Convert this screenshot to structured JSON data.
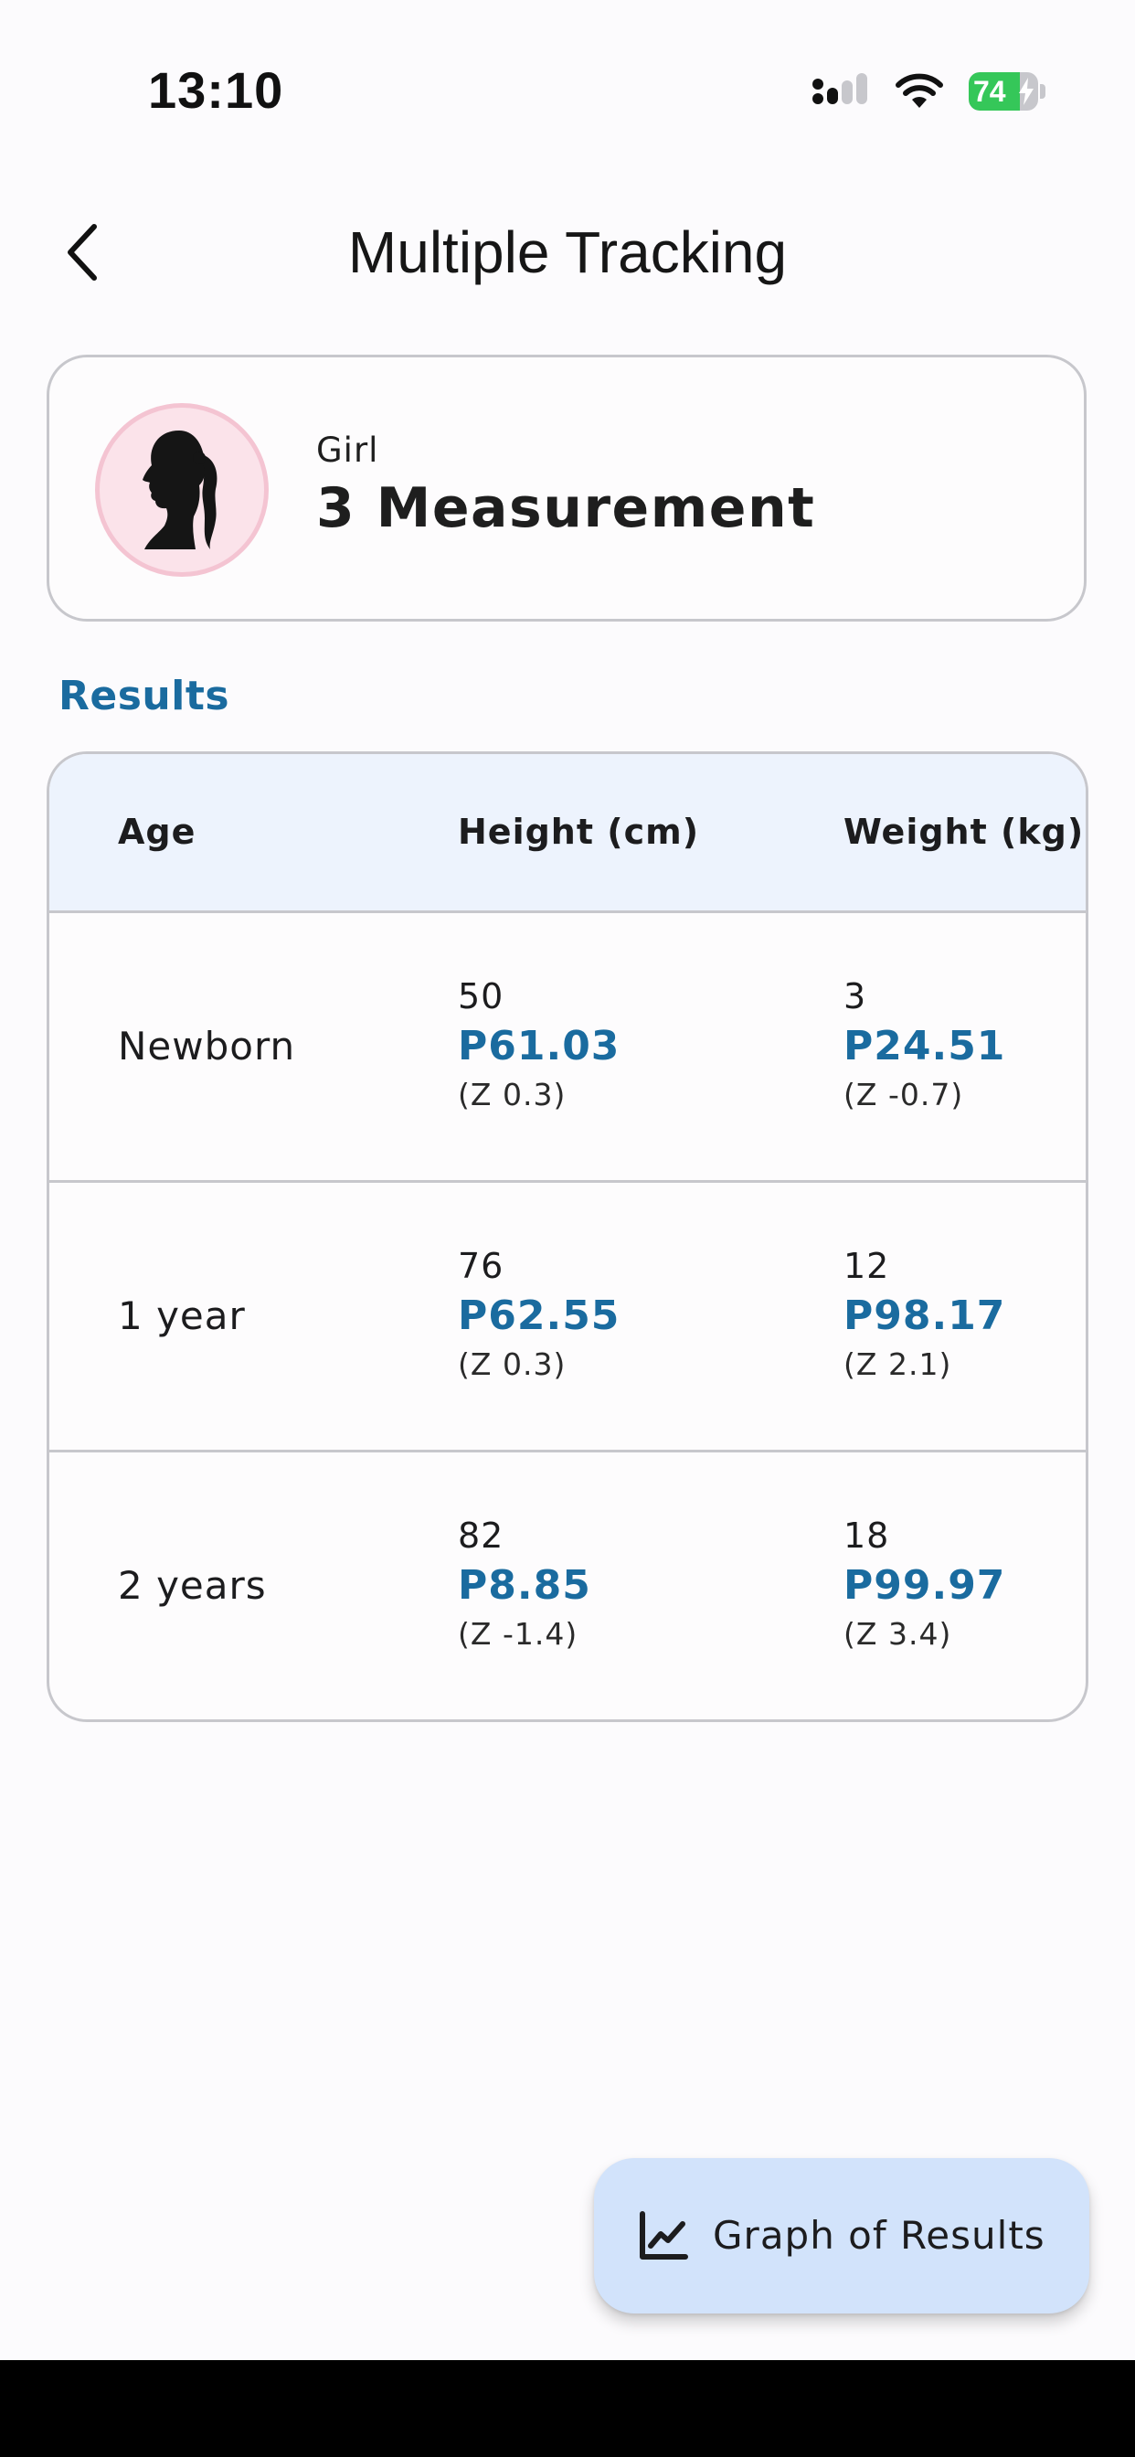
{
  "status_bar": {
    "time": "13:10",
    "battery_percent": "74",
    "battery_level": 0.74,
    "charging": true
  },
  "header": {
    "title": "Multiple Tracking",
    "back_icon": "chevron-left-icon"
  },
  "profile": {
    "gender_label": "Girl",
    "measurement_count": "3 Measurement",
    "avatar_icon": "girl-silhouette-icon"
  },
  "results": {
    "section_title": "Results",
    "columns": [
      "Age",
      "Height (cm)",
      "Weight (kg)"
    ],
    "rows": [
      {
        "age": "Newborn",
        "height": {
          "value": "50",
          "percentile": "P61.03",
          "z": "(Z 0.3)"
        },
        "weight": {
          "value": "3",
          "percentile": "P24.51",
          "z": "(Z -0.7)"
        }
      },
      {
        "age": "1 year",
        "height": {
          "value": "76",
          "percentile": "P62.55",
          "z": "(Z 0.3)"
        },
        "weight": {
          "value": "12",
          "percentile": "P98.17",
          "z": "(Z 2.1)"
        }
      },
      {
        "age": "2 years",
        "height": {
          "value": "82",
          "percentile": "P8.85",
          "z": "(Z -1.4)"
        },
        "weight": {
          "value": "18",
          "percentile": "P99.97",
          "z": "(Z 3.4)"
        }
      }
    ]
  },
  "fab": {
    "label": "Graph of Results",
    "icon": "line-chart-icon"
  },
  "colors": {
    "accent": "#1a6b9f",
    "header_bg": "#edf3fd",
    "fab_bg": "#d2e3fb",
    "avatar_bg": "#fbe3ea",
    "avatar_border": "#f4c4d2",
    "battery_green": "#35c759"
  }
}
